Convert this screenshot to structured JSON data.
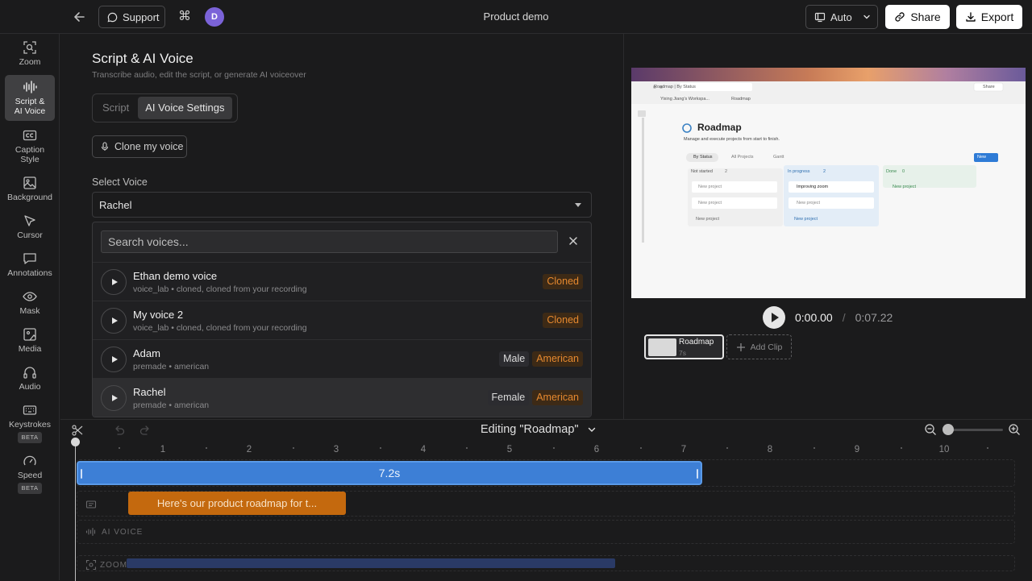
{
  "topbar": {
    "support_label": "Support",
    "cmd_glyph": "⌘",
    "avatar_letter": "D",
    "title": "Product demo",
    "auto_label": "Auto",
    "share_label": "Share",
    "export_label": "Export"
  },
  "sidebar": {
    "items": [
      {
        "label": "Zoom",
        "icon": "zoom-icon"
      },
      {
        "label": "Script & AI Voice",
        "icon": "waveform-icon"
      },
      {
        "label": "Caption Style",
        "icon": "caption-icon"
      },
      {
        "label": "Background",
        "icon": "image-icon"
      },
      {
        "label": "Cursor",
        "icon": "cursor-icon"
      },
      {
        "label": "Annotations",
        "icon": "comment-icon"
      },
      {
        "label": "Mask",
        "icon": "eye-icon"
      },
      {
        "label": "Media",
        "icon": "media-icon"
      },
      {
        "label": "Audio",
        "icon": "headphones-icon"
      },
      {
        "label": "Keystrokes",
        "icon": "keyboard-icon",
        "badge": "BETA"
      },
      {
        "label": "Speed",
        "icon": "gauge-icon",
        "badge": "BETA"
      }
    ]
  },
  "panel": {
    "title": "Script & AI Voice",
    "subtitle": "Transcribe audio, edit the script, or generate AI voiceover",
    "tabs": [
      "Script",
      "AI Voice Settings"
    ],
    "clone_label": "Clone my voice",
    "select_label": "Select Voice",
    "selected_voice": "Rachel",
    "search_placeholder": "Search voices...",
    "voices": [
      {
        "name": "Ethan demo voice",
        "meta": "voice_lab • cloned, cloned from your recording",
        "tags": [
          "Cloned"
        ]
      },
      {
        "name": "My voice 2",
        "meta": "voice_lab • cloned, cloned from your recording",
        "tags": [
          "Cloned"
        ]
      },
      {
        "name": "Adam",
        "meta": "premade • american",
        "tags": [
          "Male",
          "American"
        ]
      },
      {
        "name": "Rachel",
        "meta": "premade • american",
        "tags": [
          "Female",
          "American"
        ]
      }
    ]
  },
  "preview": {
    "time_current": "0:00.00",
    "time_sep": "/",
    "time_total": "0:07.22",
    "clip_title": "Roadmap",
    "clip_duration": "7s",
    "add_clip_label": "Add Clip",
    "screen": {
      "breadcrumb": "Yixing Jiang's Workspa...",
      "page": "Roadmap",
      "tab_title": "Roadmap | By Status",
      "heading": "Roadmap",
      "desc": "Manage and execute projects from start to finish.",
      "views": [
        "By Status",
        "All Projects",
        "Gantt"
      ],
      "new_label": "New",
      "share_label": "Share",
      "columns": [
        {
          "name": "Not started",
          "count": "2",
          "cards": [
            "New project",
            "New project"
          ],
          "add": "New project"
        },
        {
          "name": "In progress",
          "count": "2",
          "cards": [
            "Improving zoom",
            "New project"
          ],
          "add": "New project"
        },
        {
          "name": "Done",
          "count": "0",
          "cards": [],
          "add": "New project"
        }
      ]
    }
  },
  "timeline": {
    "editing_label": "Editing \"Roadmap\"",
    "ruler": [
      "1",
      "2",
      "3",
      "4",
      "5",
      "6",
      "7",
      "8",
      "9",
      "10"
    ],
    "video_clip_label": "7.2s",
    "caption_clip_label": "Here's our product roadmap for t...",
    "ai_voice_label": "AI VOICE",
    "zoom_label": "ZOOM"
  },
  "colors": {
    "accent_blue": "#3d7fd6",
    "caption_orange": "#c4690e",
    "cloned_tag": "#e6892f",
    "avatar": "#7b63d8"
  }
}
